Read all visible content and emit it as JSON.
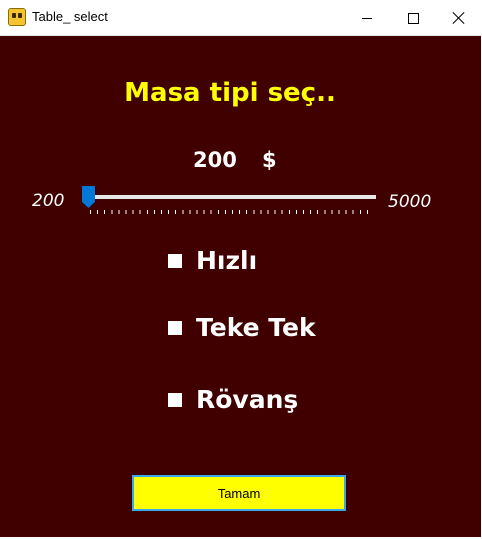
{
  "window": {
    "title": "Table_ select",
    "icon": "app-icon",
    "controls": [
      "minimize-icon",
      "maximize-icon",
      "close-icon"
    ]
  },
  "colors": {
    "background": "#400000",
    "heading": "#ffff00",
    "text": "#ffffff",
    "slider_thumb": "#0078d7",
    "button_bg": "#ffff00",
    "button_border": "#38a8e8"
  },
  "heading": "Masa tipi seç..",
  "stake": {
    "amount": "200",
    "currency": "$"
  },
  "slider": {
    "min_label": "200",
    "max_label": "5000",
    "value": 200,
    "min": 200,
    "max": 5000
  },
  "options": [
    {
      "label": "Hızlı",
      "checked": false
    },
    {
      "label": "Teke Tek",
      "checked": false
    },
    {
      "label": "Rövanş",
      "checked": false
    }
  ],
  "ok_button": "Tamam"
}
